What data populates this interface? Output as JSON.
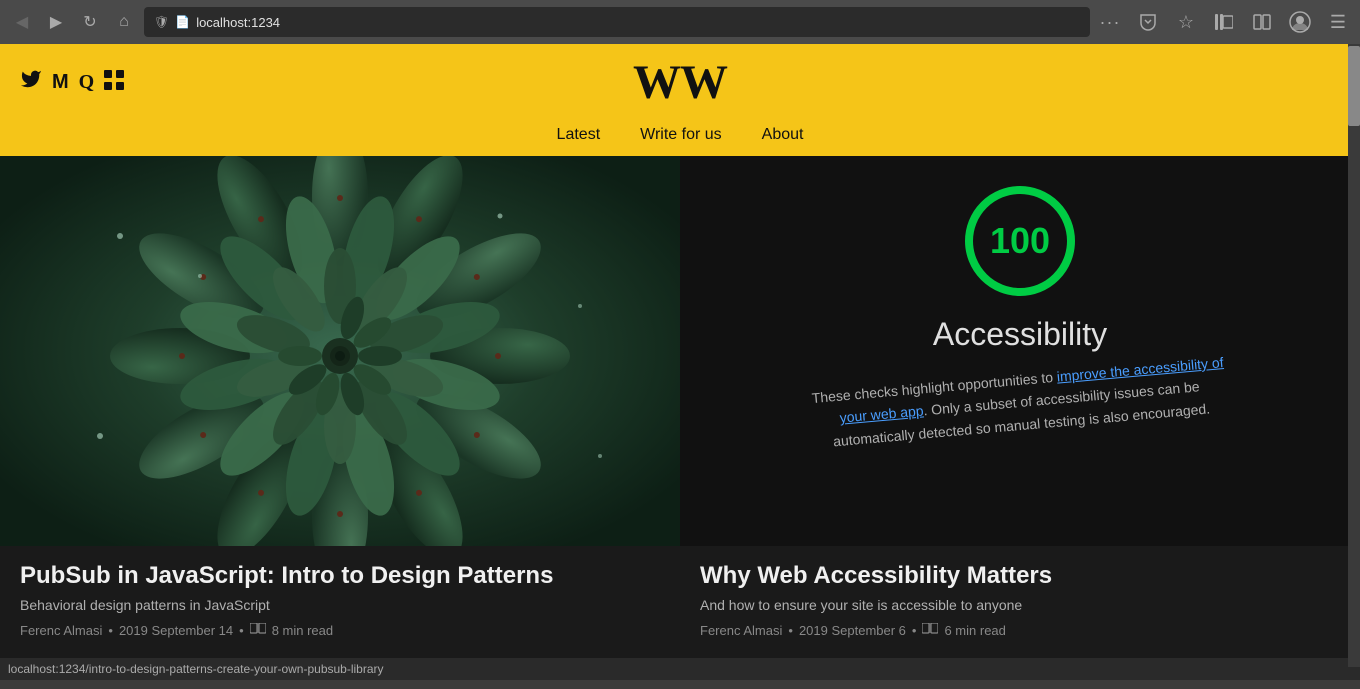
{
  "browser": {
    "url": "localhost:1234",
    "back_btn": "◀",
    "forward_btn": "▶",
    "refresh_btn": "↻",
    "home_btn": "⌂",
    "more_btn": "···",
    "pocket_btn": "pocket",
    "star_btn": "☆",
    "library_btn": "library",
    "reader_btn": "reader",
    "profile_btn": "profile",
    "menu_btn": "☰"
  },
  "site": {
    "title": "WW",
    "social_icons": {
      "twitter": "𝕋",
      "medium": "M",
      "quora": "Q",
      "squares": "⊞"
    }
  },
  "nav": {
    "items": [
      {
        "label": "Latest",
        "href": "#"
      },
      {
        "label": "Write for us",
        "href": "#"
      },
      {
        "label": "About",
        "href": "#"
      }
    ]
  },
  "posts": [
    {
      "title": "PubSub in JavaScript: Intro to Design Patterns",
      "subtitle": "Behavioral design patterns in JavaScript",
      "author": "Ferenc Almasi",
      "date": "2019 September 14",
      "read_time": "8 min read",
      "type": "left"
    },
    {
      "title": "Why Web Accessibility Matters",
      "subtitle": "And how to ensure your site is accessible to anyone",
      "author": "Ferenc Almasi",
      "date": "2019 September 6",
      "read_time": "6 min read",
      "type": "right"
    }
  ],
  "accessibility_image": {
    "score": "100",
    "title": "Accessibility",
    "text_line1": "These checks highlight opportunities to ",
    "link_text": "improve the accessibility of",
    "text_line2": "your web app",
    "text_line3": ". Only a subset of accessibility issues can be",
    "text_line4": "automatically detected so manual testing is also encouraged."
  },
  "status_bar": {
    "url": "localhost:1234/intro-to-design-patterns-create-your-own-pubsub-library"
  },
  "colors": {
    "brand_yellow": "#f5c518",
    "dark_bg": "#1a1a1a",
    "text_light": "#f0f0f0",
    "text_muted": "#b0b0b0"
  }
}
